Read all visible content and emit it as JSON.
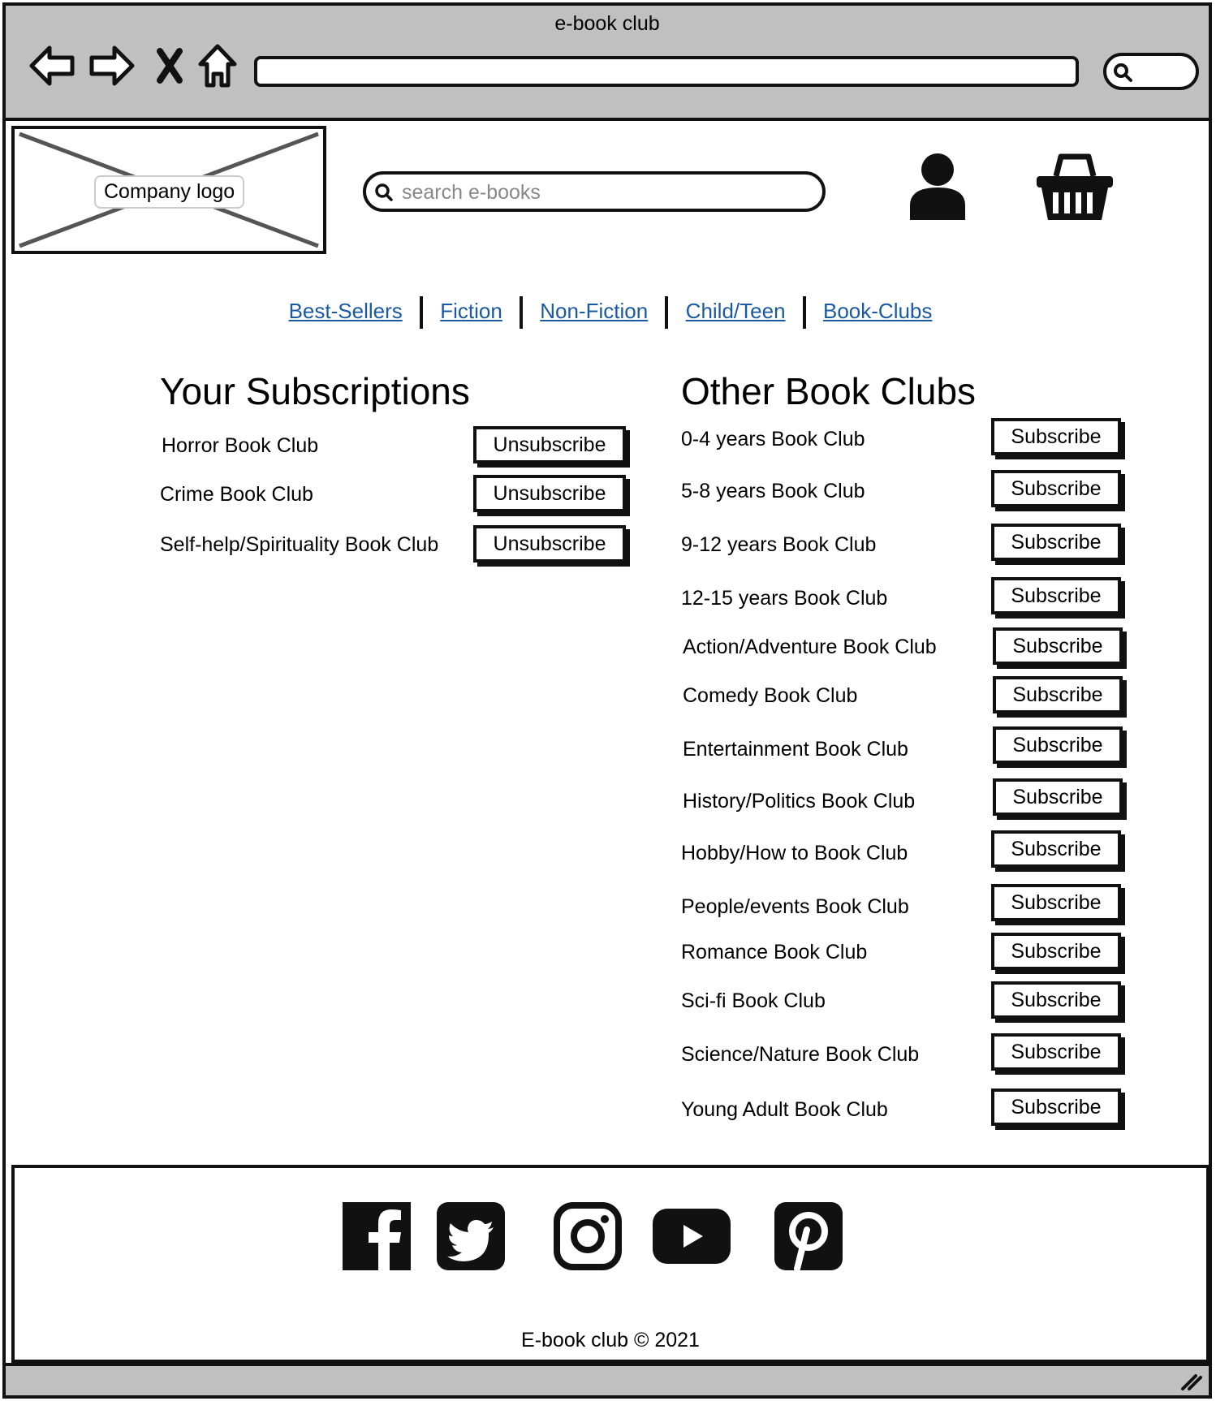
{
  "window": {
    "title": "e-book club"
  },
  "header": {
    "logo_label": "Company logo",
    "search_placeholder": "search e-books"
  },
  "nav": {
    "links": [
      "Best-Sellers",
      "Fiction",
      "Non-Fiction",
      "Child/Teen",
      "Book-Clubs"
    ]
  },
  "subscriptions": {
    "title": "Your Subscriptions",
    "button_label": "Unsubscribe",
    "items": [
      "Horror Book Club",
      "Crime Book Club",
      "Self-help/Spirituality Book Club"
    ]
  },
  "other_clubs": {
    "title": "Other Book Clubs",
    "button_label": "Subscribe",
    "items": [
      "0-4 years Book Club",
      "5-8 years Book Club",
      "9-12 years Book Club",
      "12-15 years Book Club",
      "Action/Adventure Book Club",
      "Comedy Book Club",
      "Entertainment Book Club",
      "History/Politics Book Club",
      "Hobby/How to Book Club",
      "People/events Book Club",
      "Romance Book Club",
      "Sci-fi Book Club",
      "Science/Nature Book Club",
      "Young Adult Book Club"
    ]
  },
  "footer": {
    "social_icons": [
      "facebook-icon",
      "twitter-icon",
      "instagram-icon",
      "youtube-icon",
      "pinterest-icon"
    ],
    "copyright": "E-book club © 2021"
  }
}
